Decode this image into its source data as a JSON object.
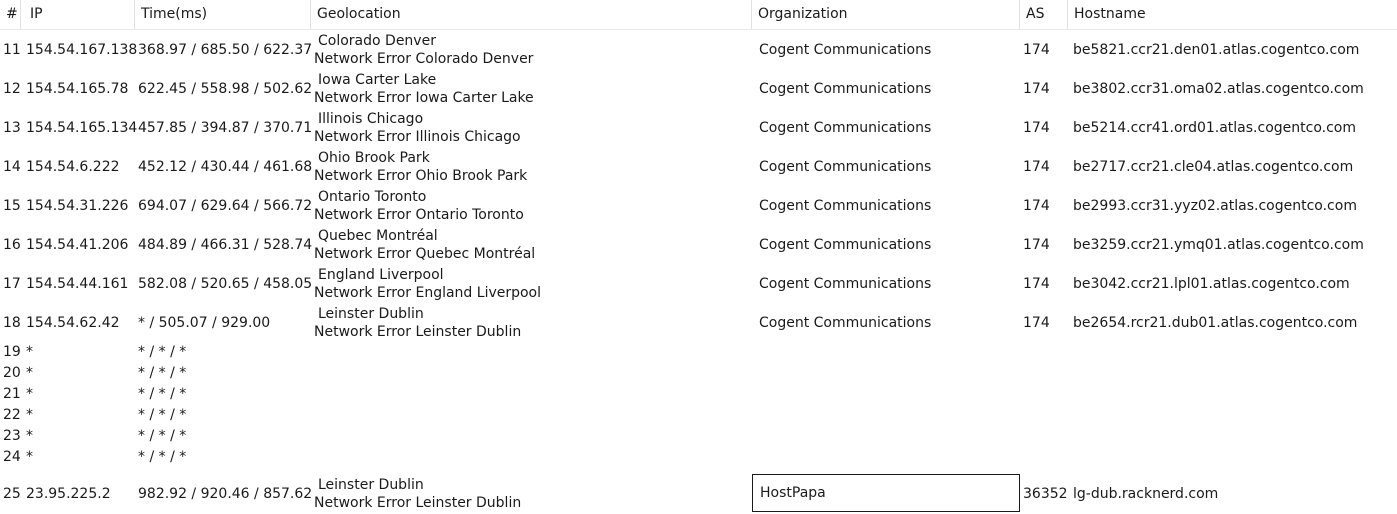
{
  "columns": [
    "#",
    "IP",
    "Time(ms)",
    "Geolocation",
    "Organization",
    "AS",
    "Hostname"
  ],
  "rows": [
    {
      "num": "11",
      "ip": "154.54.167.138",
      "time": "368.97 / 685.50 / 622.37",
      "geo1": "Colorado Denver",
      "geo2": "Network Error Colorado Denver",
      "org": "Cogent Communications",
      "as": "174",
      "host": "be5821.ccr21.den01.atlas.cogentco.com"
    },
    {
      "num": "12",
      "ip": "154.54.165.78",
      "time": "622.45 / 558.98 / 502.62",
      "geo1": "Iowa Carter Lake",
      "geo2": "Network Error Iowa Carter Lake",
      "org": "Cogent Communications",
      "as": "174",
      "host": "be3802.ccr31.oma02.atlas.cogentco.com"
    },
    {
      "num": "13",
      "ip": "154.54.165.134",
      "time": "457.85 / 394.87 / 370.71",
      "geo1": "Illinois Chicago",
      "geo2": "Network Error Illinois Chicago",
      "org": "Cogent Communications",
      "as": "174",
      "host": "be5214.ccr41.ord01.atlas.cogentco.com"
    },
    {
      "num": "14",
      "ip": "154.54.6.222",
      "time": "452.12 / 430.44 / 461.68",
      "geo1": "Ohio Brook Park",
      "geo2": "Network Error Ohio Brook Park",
      "org": "Cogent Communications",
      "as": "174",
      "host": "be2717.ccr21.cle04.atlas.cogentco.com"
    },
    {
      "num": "15",
      "ip": "154.54.31.226",
      "time": "694.07 / 629.64 / 566.72",
      "geo1": "Ontario Toronto",
      "geo2": "Network Error Ontario Toronto",
      "org": "Cogent Communications",
      "as": "174",
      "host": "be2993.ccr31.yyz02.atlas.cogentco.com"
    },
    {
      "num": "16",
      "ip": "154.54.41.206",
      "time": "484.89 / 466.31 / 528.74",
      "geo1": "Quebec Montréal",
      "geo2": "Network Error Quebec Montréal",
      "org": "Cogent Communications",
      "as": "174",
      "host": "be3259.ccr21.ymq01.atlas.cogentco.com"
    },
    {
      "num": "17",
      "ip": "154.54.44.161",
      "time": "582.08 / 520.65 / 458.05",
      "geo1": "England Liverpool",
      "geo2": "Network Error England Liverpool",
      "org": "Cogent Communications",
      "as": "174",
      "host": "be3042.ccr21.lpl01.atlas.cogentco.com"
    },
    {
      "num": "18",
      "ip": "154.54.62.42",
      "time": "* / 505.07 / 929.00",
      "geo1": "Leinster Dublin",
      "geo2": "Network Error Leinster Dublin",
      "org": "Cogent Communications",
      "as": "174",
      "host": "be2654.rcr21.dub01.atlas.cogentco.com"
    },
    {
      "num": "19",
      "ip": "*",
      "time": "* / * / *"
    },
    {
      "num": "20",
      "ip": "*",
      "time": "* / * / *"
    },
    {
      "num": "21",
      "ip": "*",
      "time": "* / * / *"
    },
    {
      "num": "22",
      "ip": "*",
      "time": "* / * / *"
    },
    {
      "num": "23",
      "ip": "*",
      "time": "* / * / *"
    },
    {
      "num": "24",
      "ip": "*",
      "time": "* / * / *"
    },
    {
      "num": "25",
      "ip": "23.95.225.2",
      "time": "982.92 / 920.46 / 857.62",
      "geo1": "Leinster Dublin",
      "geo2": "Network Error Leinster Dublin",
      "org": "HostPapa",
      "as": "36352",
      "host": "lg-dub.racknerd.com"
    }
  ]
}
